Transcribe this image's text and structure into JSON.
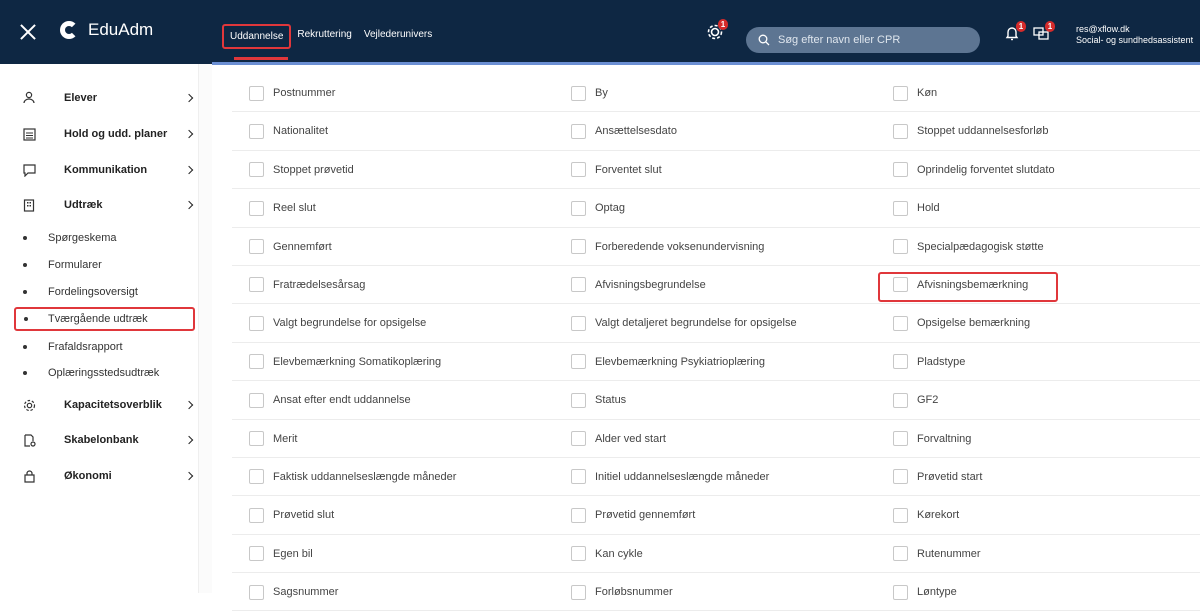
{
  "app": {
    "name": "EduAdm"
  },
  "tabs": [
    {
      "label": "Uddannelse",
      "active": true
    },
    {
      "label": "Rekruttering",
      "active": false
    },
    {
      "label": "Vejlederunivers",
      "active": false
    }
  ],
  "badges": {
    "settings": "1",
    "bell": "1",
    "chat": "1"
  },
  "search": {
    "placeholder": "Søg efter navn eller CPR"
  },
  "user": {
    "email": "res@xflow.dk",
    "role": "Social- og sundhedsassistent"
  },
  "sidebar": {
    "items": [
      {
        "label": "Elever",
        "icon": "person-icon"
      },
      {
        "label": "Hold og udd. planer",
        "icon": "calendar-list-icon"
      },
      {
        "label": "Kommunikation",
        "icon": "chat-bubble-icon"
      },
      {
        "label": "Udtræk",
        "icon": "building-icon"
      }
    ],
    "subitems": [
      {
        "label": "Spørgeskema"
      },
      {
        "label": "Formularer"
      },
      {
        "label": "Fordelingsoversigt"
      },
      {
        "label": "Tværgående udtræk",
        "active": true
      },
      {
        "label": "Frafaldsrapport"
      },
      {
        "label": "Oplæringsstedsudtræk"
      }
    ],
    "items2": [
      {
        "label": "Kapacitetsoverblik",
        "icon": "settings-icon"
      },
      {
        "label": "Skabelonbank",
        "icon": "document-gear-icon"
      },
      {
        "label": "Økonomi",
        "icon": "bag-icon"
      }
    ]
  },
  "fields": [
    [
      "Postnummer",
      "By",
      "Køn"
    ],
    [
      "Nationalitet",
      "Ansættelsesdato",
      "Stoppet uddannelsesforløb"
    ],
    [
      "Stoppet prøvetid",
      "Forventet slut",
      "Oprindelig forventet slutdato"
    ],
    [
      "Reel slut",
      "Optag",
      "Hold"
    ],
    [
      "Gennemført",
      "Forberedende voksenundervisning",
      "Specialpædagogisk støtte"
    ],
    [
      "Fratrædelsesårsag",
      "Afvisningsbegrundelse",
      "Afvisningsbemærkning"
    ],
    [
      "Valgt begrundelse for opsigelse",
      "Valgt detaljeret begrundelse for opsigelse",
      "Opsigelse bemærkning"
    ],
    [
      "Elevbemærkning Somatikoplæring",
      "Elevbemærkning Psykiatrioplæring",
      "Pladstype"
    ],
    [
      "Ansat efter endt uddannelse",
      "Status",
      "GF2"
    ],
    [
      "Merit",
      "Alder ved start",
      "Forvaltning"
    ],
    [
      "Faktisk uddannelseslængde måneder",
      "Initiel uddannelseslængde måneder",
      "Prøvetid start"
    ],
    [
      "Prøvetid slut",
      "Prøvetid gennemført",
      "Kørekort"
    ],
    [
      "Egen bil",
      "Kan cykle",
      "Rutenummer"
    ],
    [
      "Sagsnummer",
      "Forløbsnummer",
      "Løntype"
    ]
  ],
  "colors": {
    "topbar": "#0e2743",
    "accent": "#e0373b",
    "badge": "#d52b2b"
  }
}
